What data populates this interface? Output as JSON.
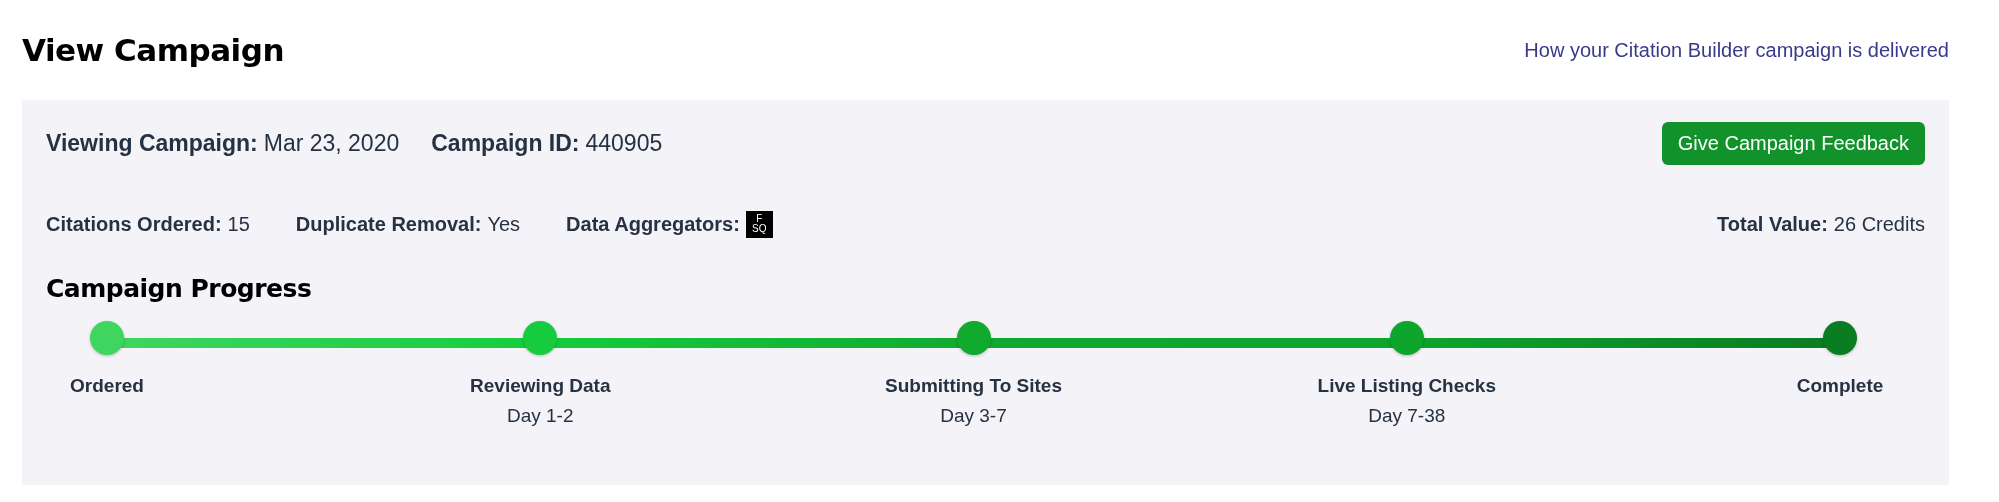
{
  "title": "View Campaign",
  "help_link": "How your Citation Builder campaign is delivered",
  "summary": [
    {
      "label": "Viewing Campaign:",
      "value": "Mar 23, 2020"
    },
    {
      "label": "Campaign ID:",
      "value": "440905"
    }
  ],
  "feedback_button": "Give Campaign Feedback",
  "details": [
    {
      "label": "Citations Ordered:",
      "value": "15"
    },
    {
      "label": "Duplicate Removal:",
      "value": "Yes"
    },
    {
      "label": "Data Aggregators:",
      "kind": "logo",
      "logo_top": "F",
      "logo_bottom": "SQ"
    }
  ],
  "total": {
    "label": "Total Value:",
    "value": "26 Credits"
  },
  "progress": {
    "title": "Campaign Progress",
    "steps": [
      {
        "label": "Ordered",
        "color": "#3fd660"
      },
      {
        "label": "Reviewing Data",
        "sublabel": "Day 1-2",
        "color": "#16cc3e"
      },
      {
        "label": "Submitting To Sites",
        "sublabel": "Day 3-7",
        "color": "#10aa2f"
      },
      {
        "label": "Live Listing Checks",
        "sublabel": "Day 7-38",
        "color": "#0da52c"
      },
      {
        "label": "Complete",
        "color": "#0a7c22"
      }
    ]
  }
}
